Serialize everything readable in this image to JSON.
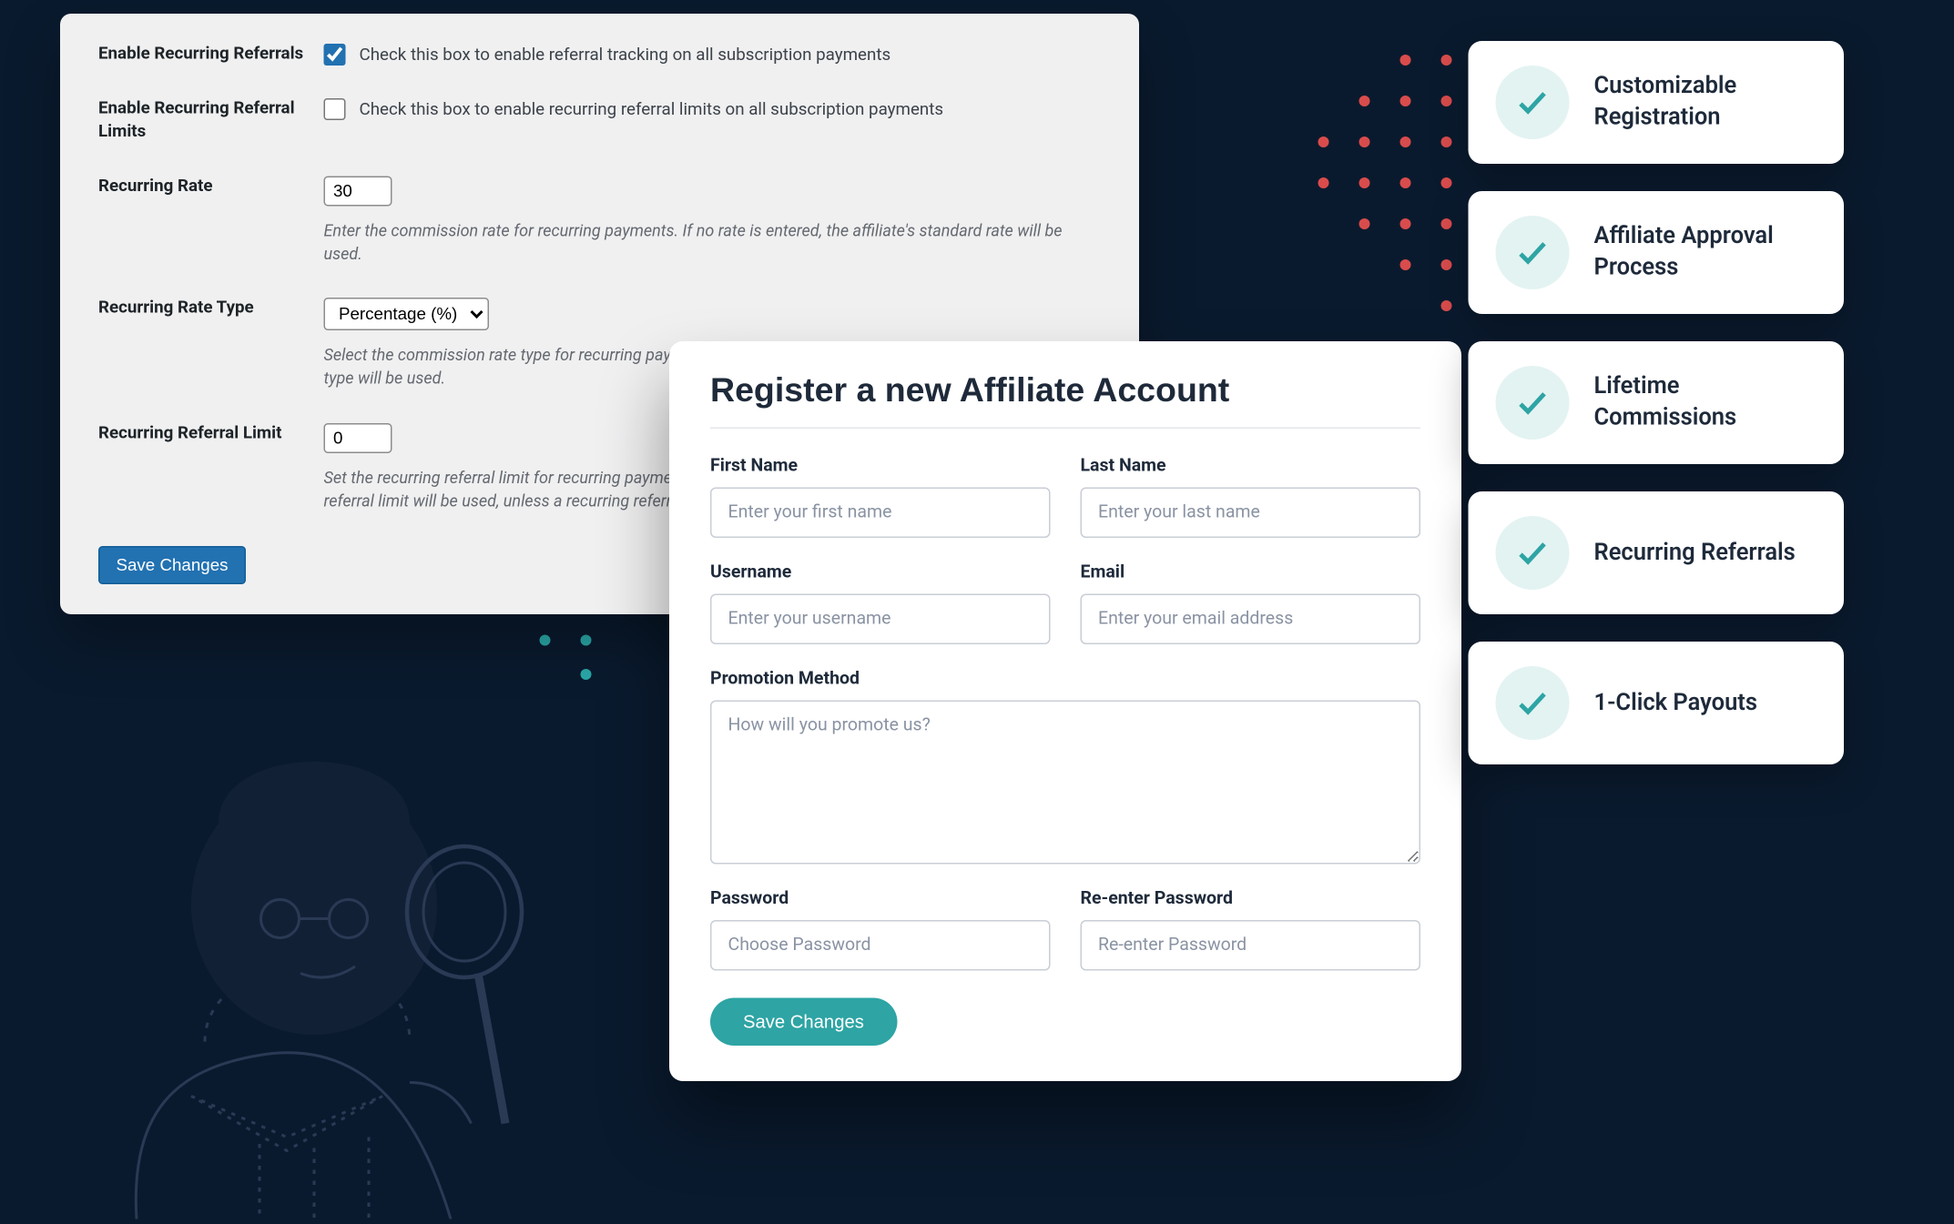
{
  "settings": {
    "rows": {
      "enable_recurring": {
        "label": "Enable Recurring Referrals",
        "text": "Check this box to enable referral tracking on all subscription payments",
        "checked": true
      },
      "enable_limits": {
        "label": "Enable Recurring Referral Limits",
        "text": "Check this box to enable recurring referral limits on all subscription payments",
        "checked": false
      },
      "recurring_rate": {
        "label": "Recurring Rate",
        "value": "30",
        "help": "Enter the commission rate for recurring payments. If no rate is entered, the affiliate's standard rate will be used."
      },
      "rate_type": {
        "label": "Recurring Rate Type",
        "value": "Percentage (%)",
        "help": "Select the commission rate type for recurring payments. If no rate type is entered, the affiliate's standard rate type will be used."
      },
      "referral_limit": {
        "label": "Recurring Referral Limit",
        "value": "0",
        "help": "Set the recurring referral limit for recurring payments. If no limit is entered, the affiliate's standard recurring referral limit will be used, unless a recurring referral limit is set."
      }
    },
    "save_label": "Save Changes"
  },
  "register": {
    "title": "Register a new Affiliate Account",
    "fields": {
      "first_name": {
        "label": "First Name",
        "placeholder": "Enter your first name"
      },
      "last_name": {
        "label": "Last Name",
        "placeholder": "Enter your last name"
      },
      "username": {
        "label": "Username",
        "placeholder": "Enter your username"
      },
      "email": {
        "label": "Email",
        "placeholder": "Enter your email address"
      },
      "promotion": {
        "label": "Promotion Method",
        "placeholder": "How will you promote us?"
      },
      "password": {
        "label": "Password",
        "placeholder": "Choose Password"
      },
      "password2": {
        "label": "Re-enter Password",
        "placeholder": "Re-enter Password"
      }
    },
    "save_label": "Save Changes"
  },
  "features": [
    {
      "label": "Customizable Registration"
    },
    {
      "label": "Affiliate Approval Process"
    },
    {
      "label": "Lifetime Commissions"
    },
    {
      "label": "Recurring Referrals"
    },
    {
      "label": "1-Click Payouts"
    }
  ]
}
